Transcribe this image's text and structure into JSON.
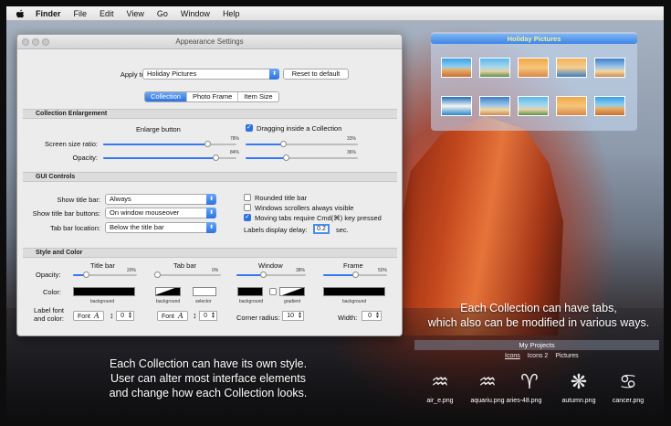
{
  "menubar": {
    "items": [
      {
        "label": "Finder",
        "bold": true
      },
      {
        "label": "File"
      },
      {
        "label": "Edit"
      },
      {
        "label": "View"
      },
      {
        "label": "Go"
      },
      {
        "label": "Window"
      },
      {
        "label": "Help"
      }
    ]
  },
  "window": {
    "title": "Appearance Settings",
    "apply_label": "Apply to:",
    "apply_value": "Holiday Pictures",
    "reset_label": "Reset to default",
    "tabs": [
      {
        "label": "Collection",
        "selected": true
      },
      {
        "label": "Photo Frame",
        "selected": false
      },
      {
        "label": "Item Size",
        "selected": false
      }
    ],
    "enlargement": {
      "header": "Collection Enlargement",
      "enlarge_button_label": "Enlarge button",
      "screen_ratio_label": "Screen size ratio:",
      "screen_ratio_pct": "78%",
      "screen_ratio_value": 0.78,
      "opacity_label": "Opacity:",
      "opacity_pct": "84%",
      "opacity_value": 0.84,
      "dragging_label": "Dragging inside a Collection",
      "dragging_checked": true,
      "drag_ratio_pct": "33%",
      "drag_ratio_value": 0.33,
      "drag_opacity_pct": "36%",
      "drag_opacity_value": 0.36
    },
    "gui": {
      "header": "GUI Controls",
      "show_title_bar_label": "Show title bar:",
      "show_title_bar_value": "Always",
      "show_title_buttons_label": "Show title bar buttons:",
      "show_title_buttons_value": "On window mouseover",
      "tab_bar_location_label": "Tab bar location:",
      "tab_bar_location_value": "Below the title bar",
      "rounded_label": "Rounded title bar",
      "rounded_checked": false,
      "scrollers_label": "Windows scrollers always visible",
      "scrollers_checked": false,
      "moving_tabs_label": "Moving tabs require Cmd(⌘) key pressed",
      "moving_tabs_checked": true,
      "delay_label": "Labels display delay:",
      "delay_value": "0.2",
      "delay_unit": "sec."
    },
    "style": {
      "header": "Style and Color",
      "opacity_label": "Opacity:",
      "color_label": "Color:",
      "label_font_label_1": "Label font",
      "label_font_label_2": "and color:",
      "columns": [
        {
          "name": "Title bar",
          "pct": "20%",
          "value": 0.2
        },
        {
          "name": "Tab bar",
          "pct": "0%",
          "value": 0.0
        },
        {
          "name": "Window",
          "pct": "38%",
          "value": 0.38
        },
        {
          "name": "Frame",
          "pct": "50%",
          "value": 0.5
        }
      ],
      "swatch_background": "background",
      "swatch_selector": "selector",
      "swatch_gradient": "gradient",
      "font_btn": "Font",
      "font_glyph": "A",
      "size_value_1": "0",
      "size_value_2": "0",
      "corner_radius_label": "Corner radius:",
      "corner_radius_value": "10",
      "width_label": "Width:",
      "width_value": "0"
    }
  },
  "holiday": {
    "title": "Holiday Pictures"
  },
  "captions": {
    "tabs_line1": "Each Collection can have tabs,",
    "tabs_line2": "which also can be modified in various ways.",
    "style_line1": "Each Collection can have its own style.",
    "style_line2": "User can alter most interface elements",
    "style_line3": "and change how each Collection looks."
  },
  "projects": {
    "title": "My Projects",
    "tabs": [
      {
        "label": "Icons",
        "selected": true
      },
      {
        "label": "Icons 2",
        "selected": false
      },
      {
        "label": "Pictures",
        "selected": false
      }
    ],
    "items": [
      {
        "name": "air_e.png",
        "glyph": "♒"
      },
      {
        "name": "aquariu.png",
        "glyph": "♒"
      },
      {
        "name": "aries-48.png",
        "glyph": "♈"
      },
      {
        "name": "autumn.png",
        "glyph": "❋"
      },
      {
        "name": "cancer.png",
        "glyph": "♋"
      }
    ]
  },
  "colors": {
    "accent": "#2d73e0",
    "holiday_title": "#f7f29a"
  }
}
